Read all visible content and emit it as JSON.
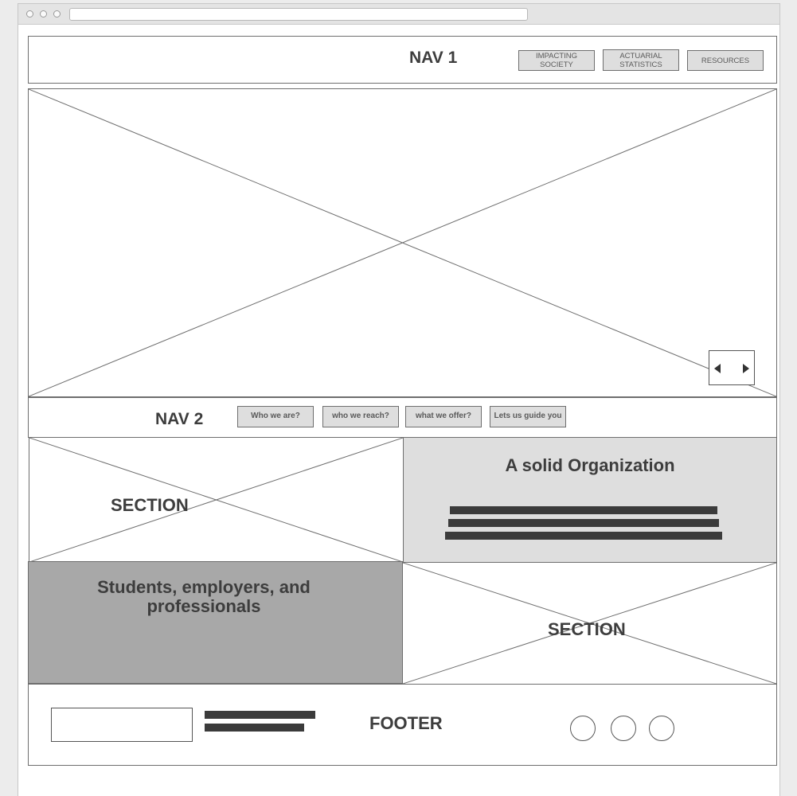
{
  "browser": {
    "window_buttons": [
      "close",
      "minimize",
      "zoom"
    ]
  },
  "nav1": {
    "title": "NAV 1",
    "buttons": [
      {
        "label": "IMPACTING SOCIETY"
      },
      {
        "label": "ACTUARIAL STATISTICS"
      },
      {
        "label": "RESOURCES"
      }
    ]
  },
  "hero": {
    "slider_controls": {
      "prev_icon": "triangle-left",
      "next_icon": "triangle-right"
    }
  },
  "nav2": {
    "title": "NAV 2",
    "buttons": [
      {
        "label": "Who we are?"
      },
      {
        "label": "who we reach?"
      },
      {
        "label": "what we offer?"
      },
      {
        "label": "Lets us guide you"
      }
    ]
  },
  "sections": {
    "top_left_label": "SECTION",
    "top_right_heading": "A solid Organization",
    "bottom_left_heading": "Students, employers, and professionals",
    "bottom_right_label": "SECTION"
  },
  "footer": {
    "title": "FOOTER",
    "social_icons": [
      "circle",
      "circle",
      "circle"
    ]
  },
  "colors": {
    "panel_light": "#dedede",
    "panel_dark": "#a8a8a8",
    "text_dark": "#3d3d3d",
    "line": "#6e6e6e"
  }
}
